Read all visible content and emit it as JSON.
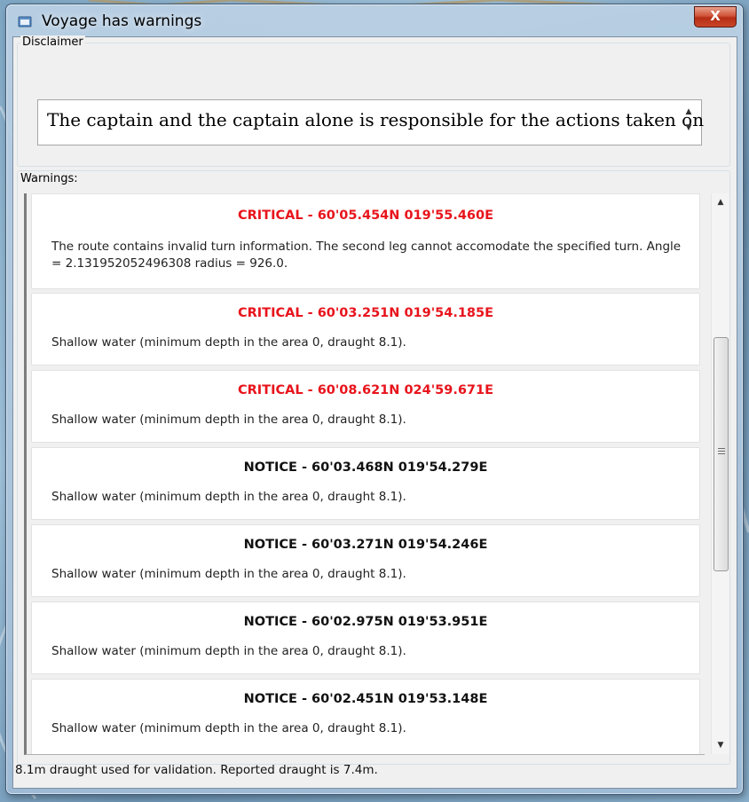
{
  "window": {
    "title": "Voyage has warnings",
    "close_label": "X"
  },
  "disclaimer": {
    "label": "Disclaimer",
    "text": "The captain and the captain alone is responsible for the actions taken on"
  },
  "warnings": {
    "label": "Warnings:",
    "items": [
      {
        "severity": "critical",
        "heading": "CRITICAL - 60'05.454N 019'55.460E",
        "body": "The route contains invalid turn information. The second leg cannot accomodate the specified turn. Angle = 2.131952052496308 radius = 926.0."
      },
      {
        "severity": "critical",
        "heading": "CRITICAL - 60'03.251N 019'54.185E",
        "body": "Shallow water (minimum depth in the area 0, draught 8.1)."
      },
      {
        "severity": "critical",
        "heading": "CRITICAL - 60'08.621N 024'59.671E",
        "body": "Shallow water (minimum depth in the area 0, draught 8.1)."
      },
      {
        "severity": "notice",
        "heading": "NOTICE - 60'03.468N 019'54.279E",
        "body": "Shallow water (minimum depth in the area 0, draught 8.1)."
      },
      {
        "severity": "notice",
        "heading": "NOTICE - 60'03.271N 019'54.246E",
        "body": "Shallow water (minimum depth in the area 0, draught 8.1)."
      },
      {
        "severity": "notice",
        "heading": "NOTICE - 60'02.975N 019'53.951E",
        "body": "Shallow water (minimum depth in the area 0, draught 8.1)."
      },
      {
        "severity": "notice",
        "heading": "NOTICE - 60'02.451N 019'53.148E",
        "body": "Shallow water (minimum depth in the area 0, draught 8.1)."
      }
    ]
  },
  "status": {
    "text": "8.1m draught used for validation. Reported draught is 7.4m."
  },
  "colors": {
    "critical": "#e8141c",
    "notice": "#111111",
    "close_button": "#c9462a"
  }
}
